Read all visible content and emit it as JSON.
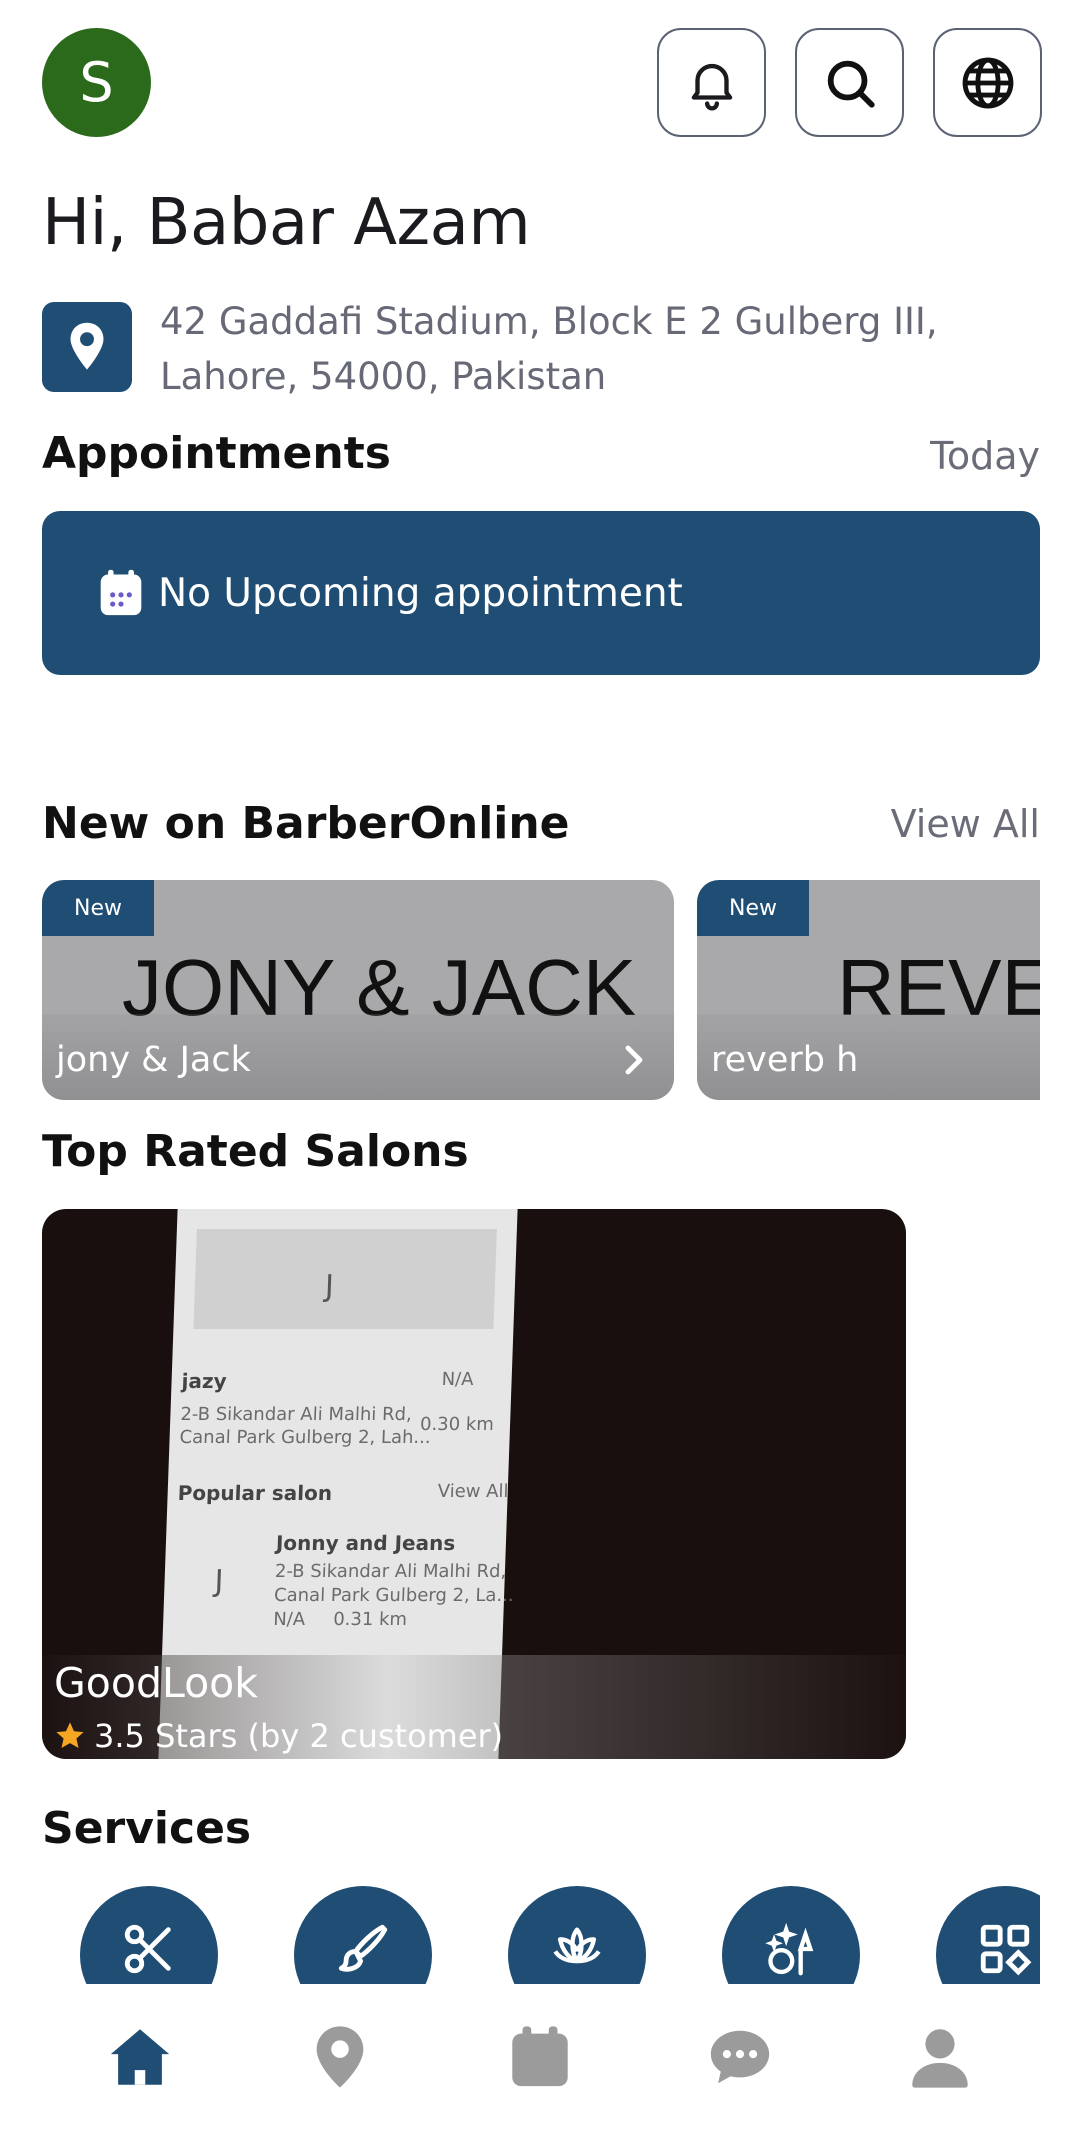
{
  "header": {
    "avatar_initial": "S",
    "icons": [
      "bell-icon",
      "search-icon",
      "globe-icon"
    ]
  },
  "greeting": "Hi, Babar Azam",
  "location": {
    "address": "42 Gaddafi Stadium, Block E 2 Gulberg III, Lahore, 54000, Pakistan"
  },
  "appointments": {
    "title": "Appointments",
    "filter": "Today",
    "empty_text": "No Upcoming appointment"
  },
  "new_section": {
    "title": "New on BarberOnline",
    "view_all": "View All",
    "cards": [
      {
        "badge": "New",
        "image_text": "JONY & JACK",
        "name": "jony & Jack"
      },
      {
        "badge": "New",
        "image_text": "REVERB",
        "name": "reverb h"
      }
    ]
  },
  "top_rated": {
    "title": "Top Rated Salons",
    "salon_name": "GoodLook",
    "rating_text": "3.5 Stars (by 2 customer)",
    "photo_text": {
      "letter1": "J",
      "s1_name": "jazy",
      "s1_na": "N/A",
      "s1_addr1": "2-B Sikandar Ali Malhi Rd,",
      "s1_addr2": "Canal Park Gulberg 2, Lah...",
      "s1_dist": "0.30 km",
      "popular": "Popular salon",
      "popular_view": "View All",
      "letter2": "J",
      "s2_name": "Jonny and Jeans",
      "s2_addr1": "2-B Sikandar Ali Malhi Rd,",
      "s2_addr2": "Canal Park Gulberg 2, La...",
      "s2_na": "N/A",
      "s2_dist": "0.31 km"
    }
  },
  "services": {
    "title": "Services",
    "icons": [
      "scissors-icon",
      "brush-icon",
      "lotus-icon",
      "makeup-icon",
      "grid-icon"
    ]
  },
  "bottom_nav": [
    "home-icon",
    "map-pin-icon",
    "calendar-icon",
    "chat-icon",
    "profile-icon"
  ],
  "colors": {
    "primary": "#1f4d73",
    "avatar": "#2c6a1b",
    "muted_text": "#676a76",
    "nav_inactive": "#9b9b9b"
  }
}
